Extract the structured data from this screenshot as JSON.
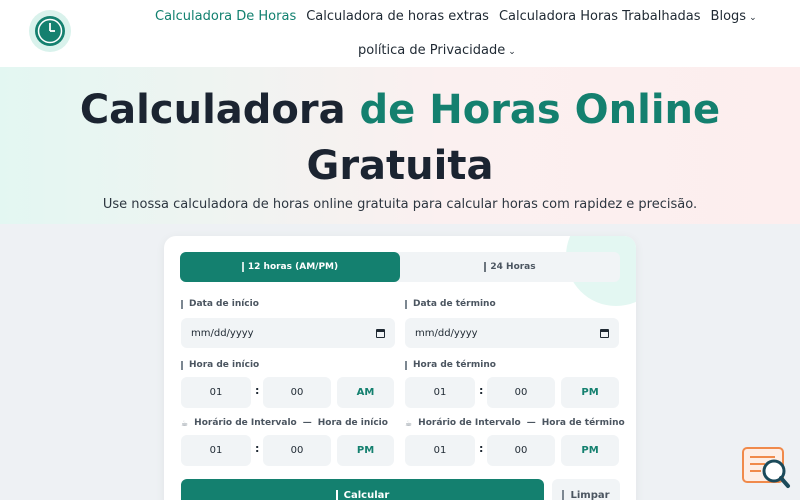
{
  "nav": {
    "items": [
      {
        "label": "Calculadora De Horas",
        "active": true
      },
      {
        "label": "Calculadora de horas extras"
      },
      {
        "label": "Calculadora Horas Trabalhadas"
      },
      {
        "label": "Blogs",
        "dropdown": true
      }
    ],
    "privacy": "política de Privacidade"
  },
  "hero": {
    "title_part1": "Calculadora ",
    "title_accent": "de Horas Online",
    "title_part2": "Gratuita",
    "subtitle": "Use nossa calculadora de horas online gratuita para calcular horas com rapidez e precisão."
  },
  "calculator": {
    "tabs": [
      "12 horas (AM/PM)",
      "24 Horas"
    ],
    "start_date_label": "Data de início",
    "end_date_label": "Data de término",
    "date_placeholder": "mm/dd/yyyy",
    "start_time_label": "Hora de início",
    "end_time_label": "Hora de término",
    "start_time": {
      "hour": "01",
      "minute": "00",
      "ampm": "AM"
    },
    "end_time": {
      "hour": "01",
      "minute": "00",
      "ampm": "PM"
    },
    "break_label": "Horário de Intervalo",
    "break_start_sub": "Hora de início",
    "break_end_sub": "Hora de término",
    "break_start": {
      "hour": "01",
      "minute": "00",
      "ampm": "PM"
    },
    "break_end": {
      "hour": "01",
      "minute": "00",
      "ampm": "PM"
    },
    "colon": ":",
    "dash": "—",
    "calc_button": "Calcular",
    "clear_button": "Limpar"
  },
  "colors": {
    "accent": "#14806f",
    "field_bg": "#f1f4f6"
  }
}
